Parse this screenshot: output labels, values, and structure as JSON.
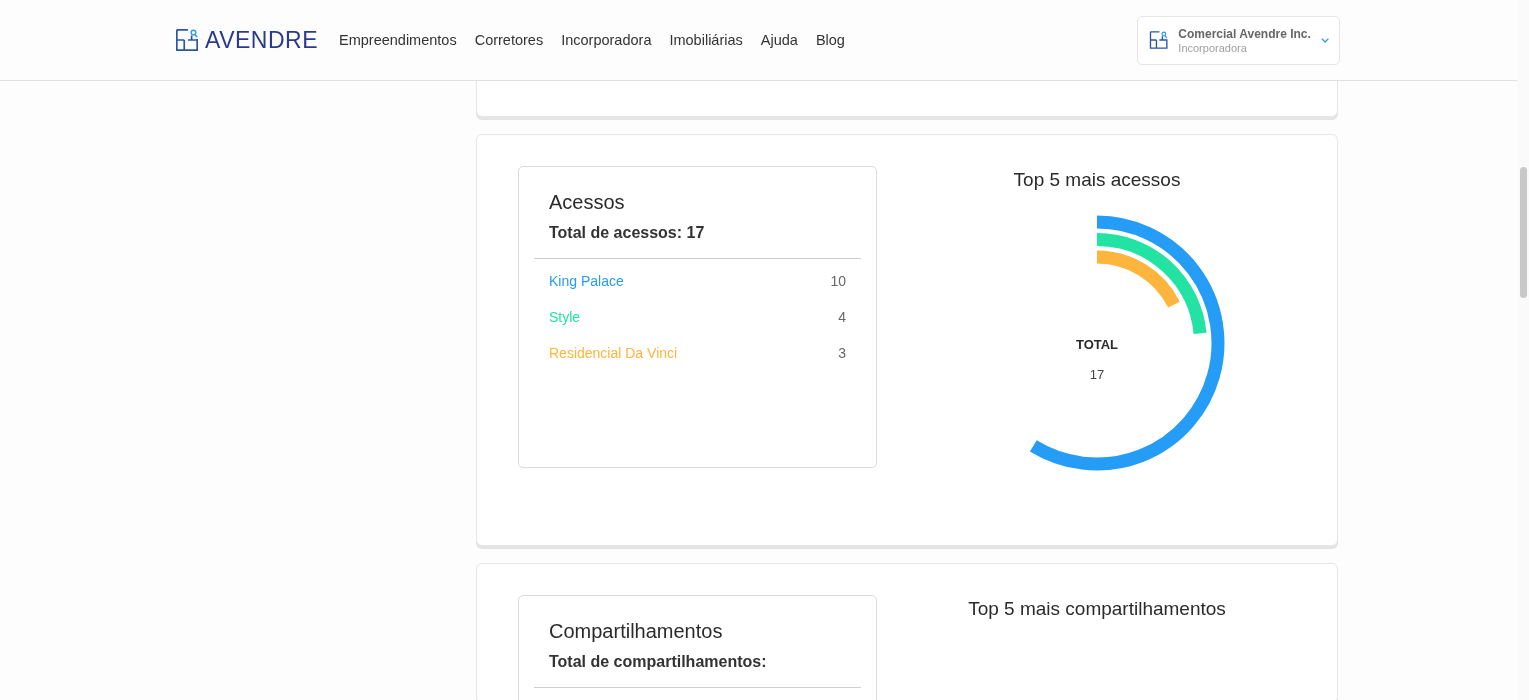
{
  "header": {
    "brand": "AVENDRE",
    "nav": [
      "Empreendimentos",
      "Corretores",
      "Incorporadora",
      "Imobiliárias",
      "Ajuda",
      "Blog"
    ],
    "account": {
      "name": "Comercial Avendre Inc.",
      "role": "Incorporadora"
    }
  },
  "sections": [
    {
      "title": "Acessos",
      "total": "Total de acessos: 17",
      "chart_title": "Top 5 mais acessos",
      "center_label": "TOTAL",
      "center_value": "17",
      "items": [
        {
          "name": "King Palace",
          "count": "10",
          "color": "#259cf5"
        },
        {
          "name": "Style",
          "count": "4",
          "color": "#22e3a4"
        },
        {
          "name": "Residencial Da Vinci",
          "count": "3",
          "color": "#fdb53d"
        }
      ]
    },
    {
      "title": "Compartilhamentos",
      "total": "Total de compartilhamentos:",
      "chart_title": "Top 5 mais compartilhamentos"
    }
  ]
}
